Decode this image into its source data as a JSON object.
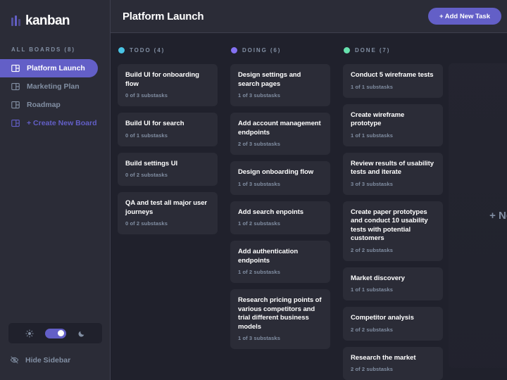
{
  "sidebar": {
    "logo_text": "kanban",
    "boards_heading": "ALL BOARDS (8)",
    "boards": [
      {
        "label": "Platform Launch",
        "active": true
      },
      {
        "label": "Marketing Plan",
        "active": false
      },
      {
        "label": "Roadmap",
        "active": false
      }
    ],
    "create_board_label": "+ Create New Board",
    "hide_sidebar_label": "Hide Sidebar",
    "theme": {
      "mode": "dark",
      "toggle_on": true
    }
  },
  "header": {
    "title": "Platform Launch",
    "add_task_label": "+ Add New Task"
  },
  "board": {
    "new_column_label": "+ New",
    "columns": [
      {
        "name": "TODO (4)",
        "dot_color": "#49c4e5",
        "cards": [
          {
            "title": "Build UI for onboarding flow",
            "subtasks": "0 of 3 substasks"
          },
          {
            "title": "Build UI for search",
            "subtasks": "0 of 1 substasks"
          },
          {
            "title": "Build settings UI",
            "subtasks": "0 of 2 substasks"
          },
          {
            "title": "QA and test all major user journeys",
            "subtasks": "0 of 2 substasks"
          }
        ]
      },
      {
        "name": "DOING (6)",
        "dot_color": "#8471f2",
        "cards": [
          {
            "title": "Design settings and search pages",
            "subtasks": "1 of 3 substasks"
          },
          {
            "title": "Add account management endpoints",
            "subtasks": "2 of 3 substasks"
          },
          {
            "title": "Design onboarding flow",
            "subtasks": "1 of 3 substasks"
          },
          {
            "title": "Add search enpoints",
            "subtasks": "1 of 2 substasks"
          },
          {
            "title": "Add authentication endpoints",
            "subtasks": "1 of 2 substasks"
          },
          {
            "title": "Research pricing points of various competitors and trial different business models",
            "subtasks": "1 of 3 substasks"
          }
        ]
      },
      {
        "name": "DONE (7)",
        "dot_color": "#67e2ae",
        "cards": [
          {
            "title": "Conduct 5 wireframe tests",
            "subtasks": "1 of 1 substasks"
          },
          {
            "title": "Create wireframe prototype",
            "subtasks": "1 of 1 substasks"
          },
          {
            "title": "Review results of usability tests and iterate",
            "subtasks": "3 of 3 substasks"
          },
          {
            "title": "Create paper prototypes and conduct 10 usability tests with potential customers",
            "subtasks": "2 of 2 substasks"
          },
          {
            "title": "Market discovery",
            "subtasks": "1 of 1 substasks"
          },
          {
            "title": "Competitor analysis",
            "subtasks": "2 of 2 substasks"
          },
          {
            "title": "Research the market",
            "subtasks": "2 of 2 substasks"
          }
        ]
      }
    ]
  },
  "colors": {
    "accent": "#635fc7",
    "sidebar_bg": "#2b2c37",
    "board_bg": "#20212c",
    "muted_text": "#828fa3"
  }
}
